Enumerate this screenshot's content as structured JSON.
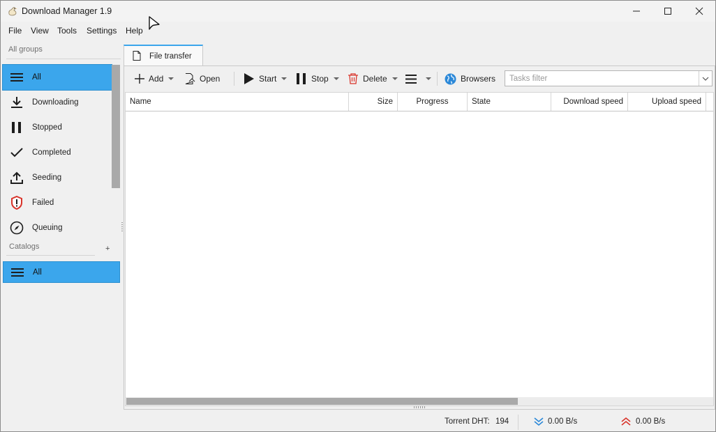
{
  "window": {
    "title": "Download Manager 1.9"
  },
  "menu": [
    {
      "label": "File"
    },
    {
      "label": "View"
    },
    {
      "label": "Tools"
    },
    {
      "label": "Settings"
    },
    {
      "label": "Help"
    }
  ],
  "sidebar": {
    "header": "All groups",
    "items": [
      {
        "label": "All",
        "icon": "list-icon",
        "selected": true
      },
      {
        "label": "Downloading",
        "icon": "download-icon"
      },
      {
        "label": "Stopped",
        "icon": "pause-icon"
      },
      {
        "label": "Completed",
        "icon": "check-icon"
      },
      {
        "label": "Seeding",
        "icon": "upload-icon"
      },
      {
        "label": "Failed",
        "icon": "shield-alert-icon"
      },
      {
        "label": "Queuing",
        "icon": "compass-icon"
      }
    ],
    "catalogs_header": "Catalogs",
    "catalogs_add": "+",
    "catalogs": [
      {
        "label": "All",
        "icon": "list-icon",
        "selected": true
      }
    ]
  },
  "tabs": [
    {
      "label": "File transfer",
      "icon": "document-icon"
    }
  ],
  "toolbar": {
    "add": "Add",
    "open": "Open",
    "start": "Start",
    "stop": "Stop",
    "delete": "Delete",
    "browsers": "Browsers",
    "filter_placeholder": "Tasks filter",
    "filter_value": ""
  },
  "table": {
    "columns": [
      "Name",
      "Size",
      "Progress",
      "State",
      "Download speed",
      "Upload speed"
    ],
    "rows": []
  },
  "status": {
    "dht_label": "Torrent DHT:",
    "dht_value": "194",
    "download_speed": "0.00 B/s",
    "upload_speed": "0.00 B/s"
  },
  "colors": {
    "selection": "#3ba6ec",
    "delete_red": "#d9342b",
    "download_blue": "#2b88d8",
    "upload_red": "#d9342b"
  }
}
